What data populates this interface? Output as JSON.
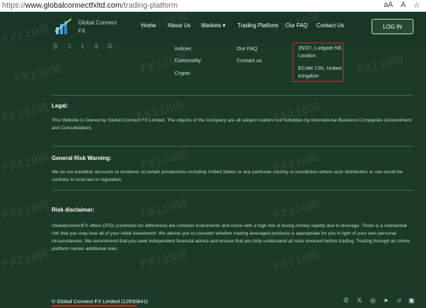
{
  "browser": {
    "url_scheme": "https://",
    "url_host": "www.globalconnectfxltd.com",
    "url_path": "/trading-platform",
    "icons": [
      "aA",
      "A",
      "☆"
    ]
  },
  "header": {
    "logo_line1": "Global Connect",
    "logo_line2": "FX",
    "nav": [
      "Home",
      "About Us",
      "Markets",
      "Trading Platform",
      "Our FAQ",
      "Contact Us"
    ],
    "login_label": "LOG IN"
  },
  "footer_links": {
    "col1": [
      "Indices",
      "Commodity",
      "Crypto"
    ],
    "col2": [
      "Our FAQ",
      "Contact us"
    ]
  },
  "address": {
    "line1a": "35/37, Ludgate hill,",
    "line1b": "London",
    "line2a": "EC4M 7JN, United",
    "line2b": "Kingdom"
  },
  "legal": {
    "title": "Legal:",
    "text": "This Website is Owned by Global Connect FX Limited. The objects of the Company are all subject matters not forbidden by International Business Companies (Amendment and Consolidation)."
  },
  "risk_warning": {
    "title": "General Risk Warning:",
    "text": "We do not establish accounts to residents of certain jurisdictions including United States or any particular country or jurisdiction where such distribution or use would be contrary to local law or regulation"
  },
  "risk_disclaimer": {
    "title": "Risk disclaimer:",
    "text": "GlobalconnectFX offers CFDs (contracts for difference) are complex instruments and come with a high risk of losing money rapidly due to leverage. There is a substantial risk that you may lose all of your initial investment. We advise you to consider whether trading leveraged products is appropriate for you in light of your own personal circumstances. We recommend that you seek independent financial advice and ensure that you fully understand all risks involved before trading. Trading through an online platform carries additional risks."
  },
  "copyright": "© Global Connect FX Limited (12930841)",
  "watermark": "FX110网",
  "colors": {
    "background": "#1c3a28",
    "header": "#1a3626",
    "highlight": "#d8262a"
  }
}
